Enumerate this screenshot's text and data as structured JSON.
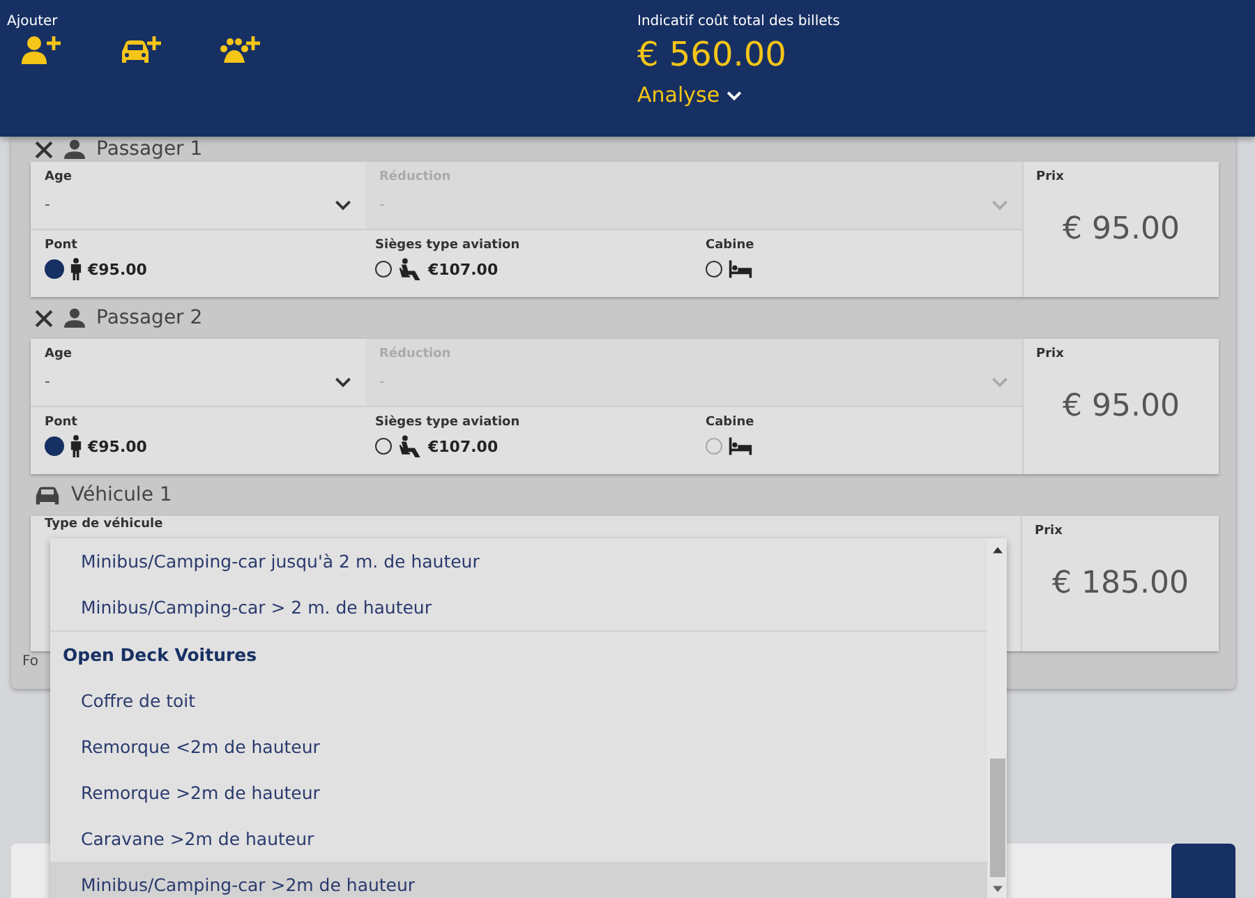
{
  "header": {
    "add_label": "Ajouter",
    "add_buttons": [
      {
        "kind": "person"
      },
      {
        "kind": "vehicle"
      },
      {
        "kind": "pet"
      }
    ],
    "total_label": "Indicatif coût total des billets",
    "total": "€ 560.00",
    "analyse": "Analyse"
  },
  "passengers": [
    {
      "title": "Passager 1",
      "age_label": "Age",
      "age_value": "-",
      "reduction_label": "Réduction",
      "reduction_value": "-",
      "reduction_disabled": true,
      "price_label": "Prix",
      "price": "€ 95.00",
      "options": [
        {
          "kind": "deck",
          "label": "Pont",
          "price": "€95.00",
          "selected": true,
          "disabled": false
        },
        {
          "kind": "seat",
          "label": "Sièges type aviation",
          "price": "€107.00",
          "selected": false,
          "disabled": false
        },
        {
          "kind": "cabin",
          "label": "Cabine",
          "selected": false,
          "disabled": false
        }
      ]
    },
    {
      "title": "Passager 2",
      "age_label": "Age",
      "age_value": "-",
      "reduction_label": "Réduction",
      "reduction_value": "-",
      "reduction_disabled": true,
      "price_label": "Prix",
      "price": "€ 95.00",
      "options": [
        {
          "kind": "deck",
          "label": "Pont",
          "price": "€95.00",
          "selected": true,
          "disabled": false
        },
        {
          "kind": "seat",
          "label": "Sièges type aviation",
          "price": "€107.00",
          "selected": false,
          "disabled": false
        },
        {
          "kind": "cabin",
          "label": "Cabine",
          "selected": false,
          "disabled": true
        }
      ]
    }
  ],
  "vehicle": {
    "title": "Véhicule 1",
    "type_label": "Type de véhicule",
    "price_label": "Prix",
    "price": "€ 185.00"
  },
  "footer_text": "Fo",
  "dropdown": [
    {
      "kind": "option",
      "label": "Minibus/Camping-car jusqu'à 2 m. de hauteur",
      "selected": false
    },
    {
      "kind": "option",
      "label": "Minibus/Camping-car > 2 m. de hauteur",
      "selected": false
    },
    {
      "kind": "group",
      "label": "Open Deck Voitures"
    },
    {
      "kind": "option",
      "label": "Coffre de toit",
      "selected": false
    },
    {
      "kind": "option",
      "label": "Remorque <2m de hauteur",
      "selected": false
    },
    {
      "kind": "option",
      "label": "Remorque >2m de hauteur",
      "selected": false
    },
    {
      "kind": "option",
      "label": "Caravane >2m de hauteur",
      "selected": false
    },
    {
      "kind": "option",
      "label": "Minibus/Camping-car >2m de hauteur",
      "selected": true
    }
  ]
}
